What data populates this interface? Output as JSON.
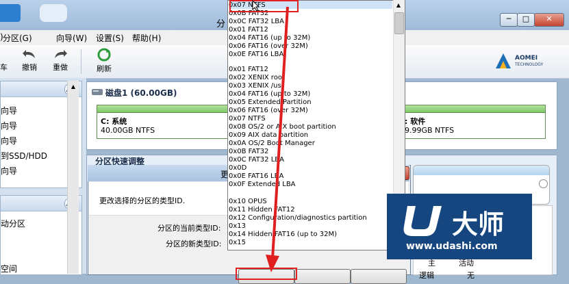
{
  "window": {
    "title_fragment": "分",
    "minimize": "─",
    "maximize": "□",
    "close": "✕"
  },
  "menubar": {
    "items": [
      "分区(G)",
      "向导(W)",
      "设置(S)",
      "帮助(H)"
    ]
  },
  "toolbar": {
    "partial_label": "车",
    "undo_label": "撤销",
    "redo_label": "重做",
    "refresh_label": "刷新"
  },
  "brand": {
    "name": "AOMEI",
    "sub": "TECHNOLOGY"
  },
  "left_panel": {
    "wizards": [
      "向导",
      "向导",
      "向导",
      "到SSD/HDD",
      "向导"
    ],
    "operations": [
      "动分区",
      "空间"
    ]
  },
  "disk": {
    "title": "磁盘1 (60.00GB)",
    "partitions": [
      {
        "name": "C: 系统",
        "size": "40.00GB NTFS"
      },
      {
        "name": ": 软件",
        "size": "9.99GB NTFS"
      }
    ]
  },
  "quick_adjust": {
    "title": "分区快速调整"
  },
  "table_fragment": {
    "col1": "主",
    "col2": "活动",
    "col3": "逻辑",
    "col4": "无"
  },
  "dialog": {
    "title_fragment": "更",
    "close": "✕",
    "description": "更改选择的分区的类型ID.",
    "current_label": "分区的当前类型ID:",
    "new_label": "分区的新类型ID:"
  },
  "dropdown": {
    "options": [
      "0x07 NTFS",
      "0x0B FAT32",
      "0x0C FAT32 LBA",
      "0x01 FAT12",
      "0x04 FAT16 (up to 32M)",
      "0x06 FAT16 (over 32M)",
      "0x0E FAT16 LBA",
      "",
      "0x01 FAT12",
      "0x02 XENIX root",
      "0x03 XENIX /usr",
      "0x04 FAT16 (up to 32M)",
      "0x05 Extended Partition",
      "0x06 FAT16 (over 32M)",
      "0x07 NTFS",
      "0x08 OS/2 or AIX boot partition",
      "0x09 AIX data partition",
      "0x0A OS/2 Boot Manager",
      "0x0B FAT32",
      "0x0C FAT32 LBA",
      "0x0D",
      "0x0E FAT16 LBA",
      "0x0F Extended LBA",
      "",
      "0x10 OPUS",
      "0x11 Hidden FAT12",
      "0x12 Configuration/diagnostics partition",
      "0x13",
      "0x14 Hidden FAT16 (up to 32M)",
      "0x15"
    ]
  },
  "watermark": {
    "text": "大师",
    "url": "www.udashi.com"
  },
  "colors": {
    "highlight": "#e02020",
    "partition_fill": "#7fc865",
    "watermark_bg": "#16467f"
  }
}
